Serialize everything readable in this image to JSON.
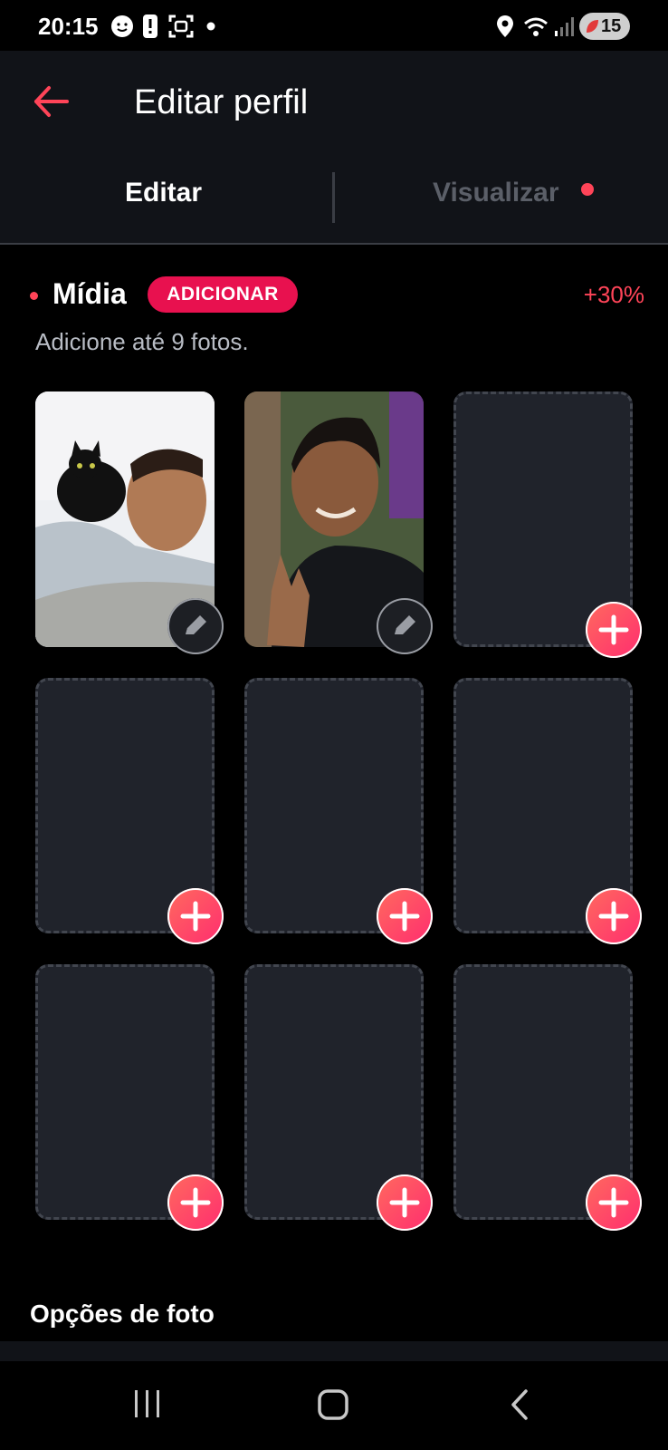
{
  "status_bar": {
    "time": "20:15",
    "battery_level": "15",
    "icons": [
      "face-notification-icon",
      "alert-icon",
      "screenshot-icon",
      "dot-icon",
      "location-icon",
      "wifi-icon",
      "signal-icon",
      "battery-icon"
    ]
  },
  "header": {
    "title": "Editar perfil",
    "back_icon": "arrow-left-icon",
    "tabs": [
      {
        "label": "Editar",
        "active": true
      },
      {
        "label": "Visualizar",
        "active": false,
        "has_notification_dot": true
      }
    ]
  },
  "media": {
    "title": "Mídia",
    "add_badge": "ADICIONAR",
    "score": "+30%",
    "hint": "Adicione até 9 fotos.",
    "slots": [
      {
        "state": "photo",
        "action_icon": "pencil-icon"
      },
      {
        "state": "photo",
        "action_icon": "pencil-icon"
      },
      {
        "state": "empty",
        "action_icon": "plus-icon"
      },
      {
        "state": "empty",
        "action_icon": "plus-icon"
      },
      {
        "state": "empty",
        "action_icon": "plus-icon"
      },
      {
        "state": "empty",
        "action_icon": "plus-icon"
      },
      {
        "state": "empty",
        "action_icon": "plus-icon"
      },
      {
        "state": "empty",
        "action_icon": "plus-icon"
      },
      {
        "state": "empty",
        "action_icon": "plus-icon"
      }
    ]
  },
  "photo_options": {
    "title": "Opções de foto"
  },
  "nav": {
    "icons": [
      "recent-apps-icon",
      "home-icon",
      "back-icon"
    ]
  },
  "colors": {
    "accent": "#ff4458",
    "badge": "#e8114f",
    "surface": "#111318",
    "tile": "#20232b",
    "background": "#000000"
  }
}
